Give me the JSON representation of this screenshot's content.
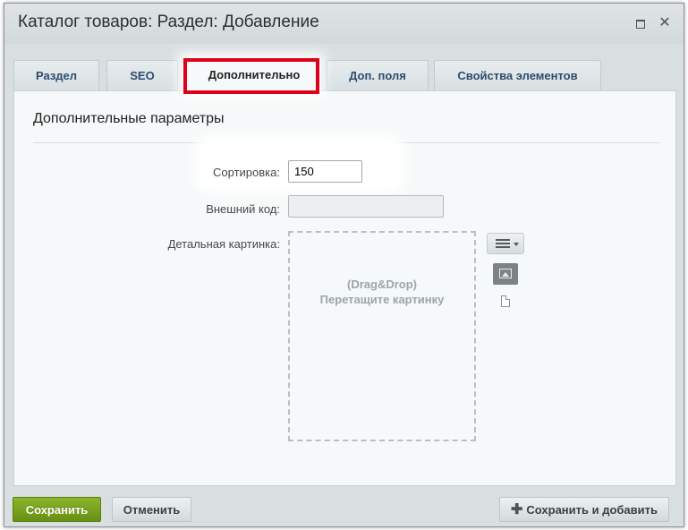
{
  "window": {
    "title": "Каталог товаров: Раздел: Добавление"
  },
  "tabs": [
    {
      "label": "Раздел",
      "active": false
    },
    {
      "label": "SEO",
      "active": false
    },
    {
      "label": "Дополнительно",
      "active": true
    },
    {
      "label": "Доп. поля",
      "active": false
    },
    {
      "label": "Свойства элементов",
      "active": false
    }
  ],
  "section": {
    "title": "Дополнительные параметры"
  },
  "form": {
    "sort_label": "Сортировка:",
    "sort_value": "150",
    "external_code_label": "Внешний код:",
    "external_code_value": "",
    "detail_picture_label": "Детальная картинка:",
    "dropzone_line1": "(Drag&Drop)",
    "dropzone_line2": "Перетащите картинку"
  },
  "icons": {
    "menu": "menu-icon",
    "image": "image-icon",
    "file": "file-icon",
    "maximize": "maximize-icon",
    "close": "close-icon",
    "plus": "plus-icon"
  },
  "buttons": {
    "save": "Сохранить",
    "cancel": "Отменить",
    "save_and_add": "Сохранить и добавить"
  },
  "colors": {
    "highlight": "#e1001a",
    "save_button": "#7aa31f"
  }
}
